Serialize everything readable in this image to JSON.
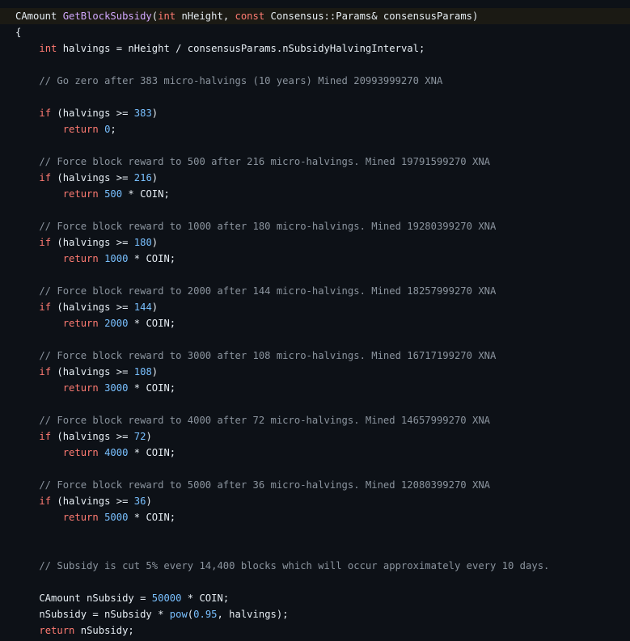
{
  "code": {
    "language": "C++",
    "signature": {
      "return_type": "CAmount ",
      "function_name": "GetBlockSubsidy",
      "open_paren": "(",
      "kw_int": "int",
      "param1": " nHeight, ",
      "kw_const": "const",
      "param2": " Consensus::Params& consensusParams)"
    },
    "open_brace": "{",
    "halvings_decl": {
      "indent": "    ",
      "kw": "int",
      "rest": " halvings = nHeight / consensusParams.nSubsidyHalvingInterval;"
    },
    "comment_zero": "    // Go zero after 383 micro-halvings (10 years) Mined 20993999270 XNA",
    "if_383": {
      "indent": "    ",
      "kw": "if",
      "pre": " (halvings >= ",
      "num": "383",
      "post": ")"
    },
    "return_0": {
      "indent": "        ",
      "kw": "return",
      "sp": " ",
      "num": "0",
      "post": ";"
    },
    "blocks": [
      {
        "comment": "    // Force block reward to 500 after 216 micro-halvings. Mined 19791599270 XNA",
        "if_indent": "    ",
        "if_kw": "if",
        "if_pre": " (halvings >= ",
        "if_num": "216",
        "if_post": ")",
        "ret_indent": "        ",
        "ret_kw": "return",
        "ret_sp": " ",
        "ret_num": "500",
        "ret_post": " * COIN;"
      },
      {
        "comment": "    // Force block reward to 1000 after 180 micro-halvings. Mined 19280399270 XNA",
        "if_indent": "    ",
        "if_kw": "if",
        "if_pre": " (halvings >= ",
        "if_num": "180",
        "if_post": ")",
        "ret_indent": "        ",
        "ret_kw": "return",
        "ret_sp": " ",
        "ret_num": "1000",
        "ret_post": " * COIN;"
      },
      {
        "comment": "    // Force block reward to 2000 after 144 micro-halvings. Mined 18257999270 XNA",
        "if_indent": "    ",
        "if_kw": "if",
        "if_pre": " (halvings >= ",
        "if_num": "144",
        "if_post": ")",
        "ret_indent": "        ",
        "ret_kw": "return",
        "ret_sp": " ",
        "ret_num": "2000",
        "ret_post": " * COIN;"
      },
      {
        "comment": "    // Force block reward to 3000 after 108 micro-halvings. Mined 16717199270 XNA",
        "if_indent": "    ",
        "if_kw": "if",
        "if_pre": " (halvings >= ",
        "if_num": "108",
        "if_post": ")",
        "ret_indent": "        ",
        "ret_kw": "return",
        "ret_sp": " ",
        "ret_num": "3000",
        "ret_post": " * COIN;"
      },
      {
        "comment": "    // Force block reward to 4000 after 72 micro-halvings. Mined 14657999270 XNA",
        "if_indent": "    ",
        "if_kw": "if",
        "if_pre": " (halvings >= ",
        "if_num": "72",
        "if_post": ")",
        "ret_indent": "        ",
        "ret_kw": "return",
        "ret_sp": " ",
        "ret_num": "4000",
        "ret_post": " * COIN;"
      },
      {
        "comment": "    // Force block reward to 5000 after 36 micro-halvings. Mined 12080399270 XNA",
        "if_indent": "    ",
        "if_kw": "if",
        "if_pre": " (halvings >= ",
        "if_num": "36",
        "if_post": ")",
        "ret_indent": "        ",
        "ret_kw": "return",
        "ret_sp": " ",
        "ret_num": "5000",
        "ret_post": " * COIN;"
      }
    ],
    "comment_cut": "    // Subsidy is cut 5% every 14,400 blocks which will occur approximately every 10 days.",
    "subsidy_decl": {
      "pre": "    CAmount nSubsidy = ",
      "num": "50000",
      "post": " * COIN;"
    },
    "subsidy_pow": {
      "pre": "    nSubsidy = nSubsidy * ",
      "fn": "pow",
      "open": "(",
      "num": "0.95",
      "post": ", halvings);"
    },
    "return_subsidy": {
      "indent": "    ",
      "kw": "return",
      "rest": " nSubsidy;"
    }
  },
  "colors": {
    "background": "#0d1117",
    "highlight_line": "#1b1a14",
    "keyword": "#ff7b72",
    "function": "#d2a8ff",
    "number": "#79c0ff",
    "comment": "#8b949e",
    "text": "#e6edf3"
  }
}
